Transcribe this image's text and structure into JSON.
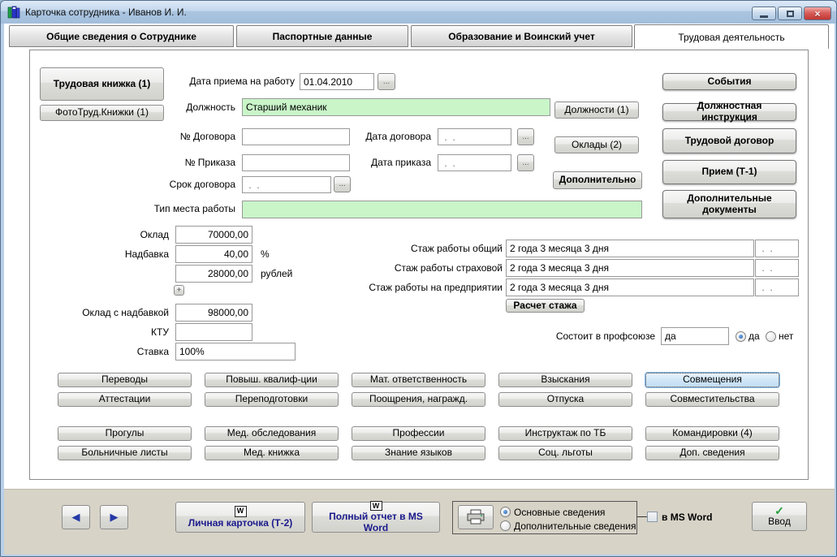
{
  "window": {
    "title": "Карточка сотрудника -  Иванов И. И.",
    "close_glyph": "×"
  },
  "colors": {
    "field_highlight_green": "#C9F5C9",
    "titlebar_blue": "#B9D0E8",
    "footer_beige": "#D7D3C7",
    "focused_button_blue": "#D2E7F8",
    "link_button_text": "#1A1A8C",
    "enter_check_green": "#1F9E38"
  },
  "tabs": [
    {
      "label": "Общие сведения о Сотруднике"
    },
    {
      "label": "Паспортные данные"
    },
    {
      "label": "Образование и Воинский учет"
    },
    {
      "label": "Трудовая деятельность"
    }
  ],
  "sidebar": {
    "work_book": "Трудовая книжка (1)",
    "work_book_photos": "ФотоТруд.Книжки (1)"
  },
  "form": {
    "hire_date_label": "Дата приема на работу",
    "hire_date_value": "01.04.2010",
    "browse_label": "...",
    "position_label": "Должность",
    "position_value": "Старший механик",
    "contract_no_label": "№ Договора",
    "contract_no_value": "",
    "contract_date_label": "Дата договора",
    "contract_date_value": " .  .",
    "order_no_label": "№ Приказа",
    "order_no_value": "",
    "order_date_label": "Дата приказа",
    "order_date_value": " .  .",
    "contract_term_label": "Срок договора",
    "contract_term_value": " .  .",
    "workplace_type_label": "Тип места работы",
    "workplace_type_value": ""
  },
  "mid_buttons": {
    "positions": "Должности (1)",
    "salaries": "Оклады (2)",
    "additional": "Дополнительно"
  },
  "action_buttons": {
    "events": "События",
    "job_description": "Должностная инструкция",
    "employment_contract": "Трудовой  договор",
    "hiring_t1": "Прием (Т-1)",
    "additional_documents": "Дополнительные документы"
  },
  "salary": {
    "base_label": "Оклад",
    "base_value": "70000,00",
    "bonus_label": "Надбавка",
    "bonus_percent_value": "40,00",
    "percent_unit": "%",
    "bonus_rub_value": "28000,00",
    "rub_unit": "рублей",
    "plus_button": "+",
    "total_label": "Оклад с надбавкой",
    "total_value": "98000,00",
    "ktu_label": "КТУ",
    "ktu_value": "",
    "rate_label": "Ставка",
    "rate_value": "100%"
  },
  "experience": {
    "rows": [
      {
        "label": "Стаж работы общий",
        "value": "2 года 3 месяца 3 дня",
        "date": " .  ."
      },
      {
        "label": "Стаж работы страховой",
        "value": "2 года 3 месяца 3 дня",
        "date": " .  ."
      },
      {
        "label": "Стаж работы на предприятии",
        "value": "2 года 3 месяца 3 дня",
        "date": " .  ."
      }
    ],
    "calc_button": "Расчет стажа"
  },
  "union": {
    "label": "Состоит в профсоюзе",
    "value": "да",
    "yes_label": "да",
    "no_label": "нет"
  },
  "grid": {
    "row1": [
      "Переводы",
      "Повыш. квалиф-ции",
      "Мат. ответственность",
      "Взыскания",
      "Совмещения"
    ],
    "row2": [
      "Аттестации",
      "Переподготовки",
      "Поощрения, награжд.",
      "Отпуска",
      "Совместительства"
    ],
    "row3": [
      "Прогулы",
      "Мед. обследования",
      "Профессии",
      "Инструктаж по ТБ",
      "Командировки (4)"
    ],
    "row4": [
      "Больничные листы",
      "Мед. книжка",
      "Знание языков",
      "Соц. льготы",
      "Доп. сведения"
    ]
  },
  "footer": {
    "prev_glyph": "◀",
    "next_glyph": "▶",
    "word_icon_glyph": "W",
    "personal_card": "Личная карточка (Т-2)",
    "full_report": "Полный отчет в MS Word",
    "print_main": "Основные сведения",
    "print_additional": "Дополнительные сведения",
    "in_ms_word": "в MS Word",
    "enter_button": "Ввод",
    "check_glyph": "✓"
  }
}
